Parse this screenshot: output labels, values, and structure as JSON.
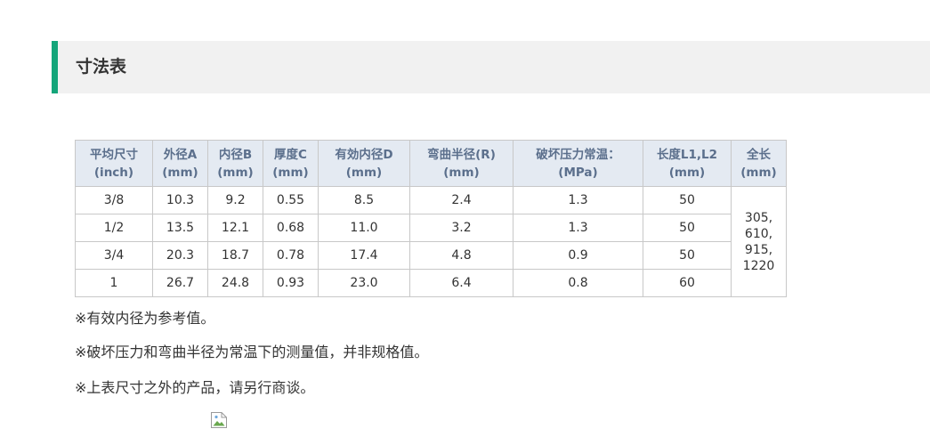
{
  "section": {
    "title": "寸法表"
  },
  "table": {
    "headers": [
      [
        "平均尺寸",
        "(inch)"
      ],
      [
        "外径A",
        "(mm)"
      ],
      [
        "内径B",
        "(mm)"
      ],
      [
        "厚度C",
        "(mm)"
      ],
      [
        "有効内径D",
        "(mm)"
      ],
      [
        "弯曲半径(R)",
        "(mm)"
      ],
      [
        "破坏压力常温：",
        "(MPa)"
      ],
      [
        "长度L1,L2",
        "(mm)"
      ],
      [
        "全长",
        "(mm)"
      ]
    ],
    "rows": [
      [
        "3/8",
        "10.3",
        "9.2",
        "0.55",
        "8.5",
        "2.4",
        "1.3",
        "50"
      ],
      [
        "1/2",
        "13.5",
        "12.1",
        "0.68",
        "11.0",
        "3.2",
        "1.3",
        "50"
      ],
      [
        "3/4",
        "20.3",
        "18.7",
        "0.78",
        "17.4",
        "4.8",
        "0.9",
        "50"
      ],
      [
        "1",
        "26.7",
        "24.8",
        "0.93",
        "23.0",
        "6.4",
        "0.8",
        "60"
      ]
    ],
    "total_length": [
      "305,",
      "610,",
      "915,",
      "1220"
    ]
  },
  "notes": [
    "※有效内径为参考值。",
    "※破坏压力和弯曲半径为常温下的测量值，并非规格值。",
    "※上表尺寸之外的产品，请另行商谈。"
  ],
  "icons": {
    "broken_image": "broken-image-icon"
  }
}
